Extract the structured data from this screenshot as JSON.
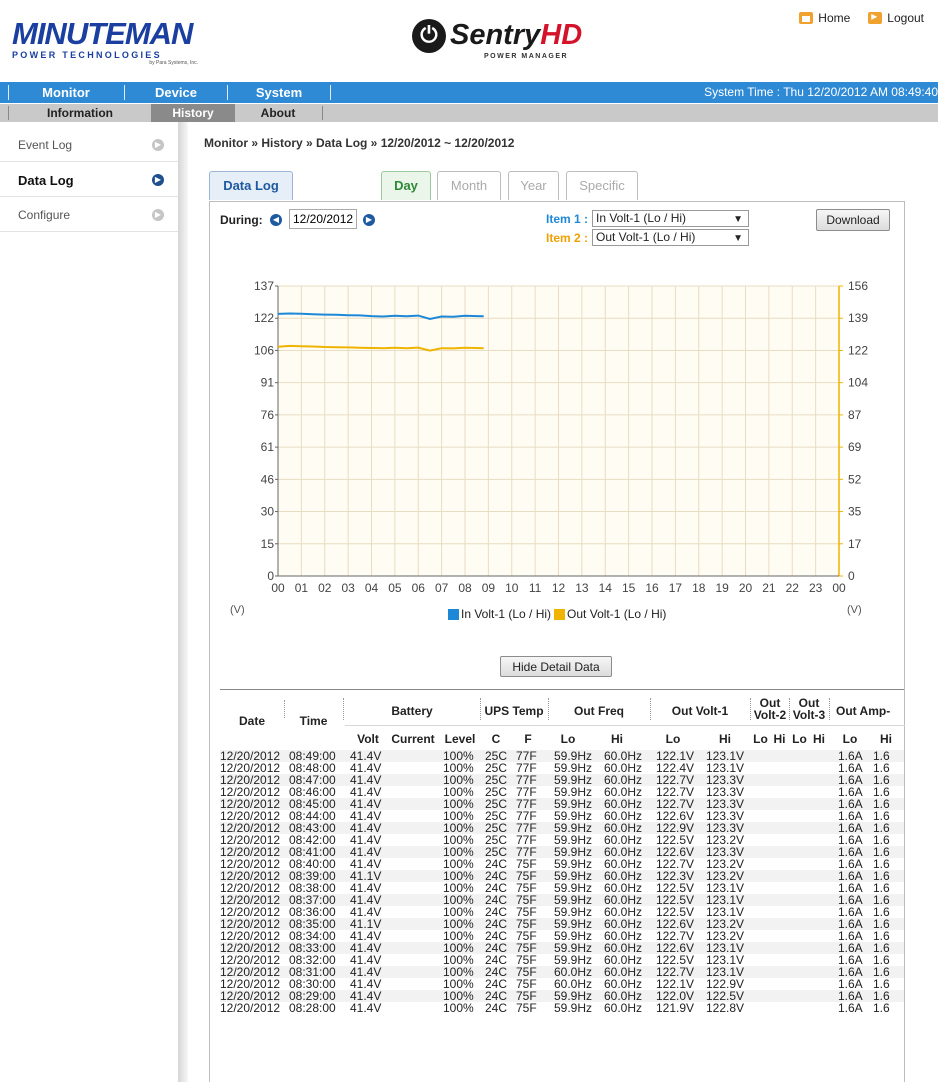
{
  "header": {
    "brand_left_big": "MINUTEMAN",
    "brand_left_sub": "POWER TECHNOLOGIES",
    "brand_left_sub2": "by Para Systems, Inc.",
    "brand_center_main": "Sentry",
    "brand_center_hd": "HD",
    "brand_center_tag": "POWER MANAGER",
    "home_label": "Home",
    "logout_label": "Logout"
  },
  "nav": {
    "monitor": "Monitor",
    "device": "Device",
    "system": "System",
    "system_time": "System Time : Thu 12/20/2012 AM 08:49:40"
  },
  "subnav": {
    "information": "Information",
    "history": "History",
    "about": "About"
  },
  "sidebar": {
    "items": [
      {
        "label": "Event Log"
      },
      {
        "label": "Data Log"
      },
      {
        "label": "Configure"
      }
    ]
  },
  "breadcrumb": "Monitor » History » Data Log  » 12/20/2012 ~ 12/20/2012",
  "tabs": {
    "data_log": "Data Log",
    "day": "Day",
    "month": "Month",
    "year": "Year",
    "specific": "Specific"
  },
  "controls": {
    "during_label": "During:",
    "date_value": "12/20/2012",
    "item1_label": "Item 1 :",
    "item1_value": "In Volt-1 (Lo / Hi)",
    "item2_label": "Item 2 :",
    "item2_value": "Out Volt-1 (Lo / Hi)",
    "download": "Download",
    "hide_detail": "Hide Detail Data"
  },
  "colors": {
    "series1": "#1e88d8",
    "series2": "#f0b400",
    "accent": "#2f8ad6",
    "grid": "#e8dcc2",
    "plot_bg": "#fffdf3"
  },
  "chart_data": {
    "type": "line",
    "x_ticks": [
      "00",
      "01",
      "02",
      "03",
      "04",
      "05",
      "06",
      "07",
      "08",
      "09",
      "10",
      "11",
      "12",
      "13",
      "14",
      "15",
      "16",
      "17",
      "18",
      "19",
      "20",
      "21",
      "22",
      "23",
      "00"
    ],
    "y_left_ticks": [
      "137",
      "122",
      "106",
      "91",
      "76",
      "61",
      "46",
      "30",
      "15",
      "0"
    ],
    "y_right_ticks": [
      "156",
      "139",
      "122",
      "104",
      "87",
      "69",
      "52",
      "35",
      "17",
      "0"
    ],
    "y_left_range": [
      0,
      137
    ],
    "y_right_range": [
      0,
      156
    ],
    "unit_left": "(V)",
    "unit_right": "(V)",
    "series": [
      {
        "name": "In Volt-1 (Lo / Hi)",
        "x": [
          0.0,
          0.5,
          1.0,
          1.5,
          2.0,
          2.5,
          3.0,
          3.5,
          4.0,
          4.5,
          5.0,
          5.5,
          6.0,
          6.5,
          7.0,
          7.5,
          8.0,
          8.5,
          8.8
        ],
        "values": [
          123.8,
          124.0,
          123.9,
          123.7,
          123.5,
          123.4,
          123.2,
          123.1,
          122.8,
          122.6,
          122.9,
          122.7,
          123.0,
          121.4,
          122.6,
          122.5,
          122.9,
          122.8,
          122.7
        ]
      },
      {
        "name": "Out Volt-1 (Lo / Hi)",
        "x": [
          0.0,
          0.5,
          1.0,
          1.5,
          2.0,
          2.5,
          3.0,
          3.5,
          4.0,
          4.5,
          5.0,
          5.5,
          6.0,
          6.5,
          7.0,
          7.5,
          8.0,
          8.5,
          8.8
        ],
        "values": [
          108.3,
          108.7,
          108.5,
          108.4,
          108.2,
          108.1,
          108.0,
          107.8,
          107.7,
          107.6,
          107.8,
          107.6,
          107.9,
          106.5,
          107.6,
          107.5,
          107.8,
          107.7,
          107.6
        ]
      }
    ]
  },
  "table": {
    "headers": {
      "date": "Date",
      "time": "Time",
      "battery": "Battery",
      "ups_temp": "UPS Temp",
      "out_freq": "Out Freq",
      "out_volt1": "Out Volt-1",
      "out_volt2a": "Out",
      "out_volt2b": "Volt-2",
      "out_volt3a": "Out",
      "out_volt3b": "Volt-3",
      "out_amp": "Out Amp-"
    },
    "subheaders": {
      "volt": "Volt",
      "current": "Current",
      "level": "Level",
      "c": "C",
      "f": "F",
      "freq_lo": "Lo",
      "freq_hi": "Hi",
      "v1_lo": "Lo",
      "v1_hi": "Hi",
      "v2_lo": "Lo",
      "v2_hi": "Hi",
      "v3_lo": "Lo",
      "v3_hi": "Hi",
      "amp_lo": "Lo",
      "amp_hi": "Hi"
    },
    "rows": [
      [
        "12/20/2012",
        "08:49:00",
        "41.4V",
        "",
        "100%",
        "25C",
        "77F",
        "59.9Hz",
        "60.0Hz",
        "122.1V",
        "123.1V",
        "1.6A",
        "1.6"
      ],
      [
        "12/20/2012",
        "08:48:00",
        "41.4V",
        "",
        "100%",
        "25C",
        "77F",
        "59.9Hz",
        "60.0Hz",
        "122.4V",
        "123.1V",
        "1.6A",
        "1.6"
      ],
      [
        "12/20/2012",
        "08:47:00",
        "41.4V",
        "",
        "100%",
        "25C",
        "77F",
        "59.9Hz",
        "60.0Hz",
        "122.7V",
        "123.3V",
        "1.6A",
        "1.6"
      ],
      [
        "12/20/2012",
        "08:46:00",
        "41.4V",
        "",
        "100%",
        "25C",
        "77F",
        "59.9Hz",
        "60.0Hz",
        "122.7V",
        "123.3V",
        "1.6A",
        "1.6"
      ],
      [
        "12/20/2012",
        "08:45:00",
        "41.4V",
        "",
        "100%",
        "25C",
        "77F",
        "59.9Hz",
        "60.0Hz",
        "122.7V",
        "123.3V",
        "1.6A",
        "1.6"
      ],
      [
        "12/20/2012",
        "08:44:00",
        "41.4V",
        "",
        "100%",
        "25C",
        "77F",
        "59.9Hz",
        "60.0Hz",
        "122.6V",
        "123.3V",
        "1.6A",
        "1.6"
      ],
      [
        "12/20/2012",
        "08:43:00",
        "41.4V",
        "",
        "100%",
        "25C",
        "77F",
        "59.9Hz",
        "60.0Hz",
        "122.9V",
        "123.3V",
        "1.6A",
        "1.6"
      ],
      [
        "12/20/2012",
        "08:42:00",
        "41.4V",
        "",
        "100%",
        "25C",
        "77F",
        "59.9Hz",
        "60.0Hz",
        "122.5V",
        "123.2V",
        "1.6A",
        "1.6"
      ],
      [
        "12/20/2012",
        "08:41:00",
        "41.4V",
        "",
        "100%",
        "25C",
        "77F",
        "59.9Hz",
        "60.0Hz",
        "122.6V",
        "123.3V",
        "1.6A",
        "1.6"
      ],
      [
        "12/20/2012",
        "08:40:00",
        "41.4V",
        "",
        "100%",
        "24C",
        "75F",
        "59.9Hz",
        "60.0Hz",
        "122.7V",
        "123.2V",
        "1.6A",
        "1.6"
      ],
      [
        "12/20/2012",
        "08:39:00",
        "41.1V",
        "",
        "100%",
        "24C",
        "75F",
        "59.9Hz",
        "60.0Hz",
        "122.3V",
        "123.2V",
        "1.6A",
        "1.6"
      ],
      [
        "12/20/2012",
        "08:38:00",
        "41.4V",
        "",
        "100%",
        "24C",
        "75F",
        "59.9Hz",
        "60.0Hz",
        "122.5V",
        "123.1V",
        "1.6A",
        "1.6"
      ],
      [
        "12/20/2012",
        "08:37:00",
        "41.4V",
        "",
        "100%",
        "24C",
        "75F",
        "59.9Hz",
        "60.0Hz",
        "122.5V",
        "123.1V",
        "1.6A",
        "1.6"
      ],
      [
        "12/20/2012",
        "08:36:00",
        "41.4V",
        "",
        "100%",
        "24C",
        "75F",
        "59.9Hz",
        "60.0Hz",
        "122.5V",
        "123.1V",
        "1.6A",
        "1.6"
      ],
      [
        "12/20/2012",
        "08:35:00",
        "41.1V",
        "",
        "100%",
        "24C",
        "75F",
        "59.9Hz",
        "60.0Hz",
        "122.6V",
        "123.2V",
        "1.6A",
        "1.6"
      ],
      [
        "12/20/2012",
        "08:34:00",
        "41.4V",
        "",
        "100%",
        "24C",
        "75F",
        "59.9Hz",
        "60.0Hz",
        "122.7V",
        "123.2V",
        "1.6A",
        "1.6"
      ],
      [
        "12/20/2012",
        "08:33:00",
        "41.4V",
        "",
        "100%",
        "24C",
        "75F",
        "59.9Hz",
        "60.0Hz",
        "122.6V",
        "123.1V",
        "1.6A",
        "1.6"
      ],
      [
        "12/20/2012",
        "08:32:00",
        "41.4V",
        "",
        "100%",
        "24C",
        "75F",
        "59.9Hz",
        "60.0Hz",
        "122.5V",
        "123.1V",
        "1.6A",
        "1.6"
      ],
      [
        "12/20/2012",
        "08:31:00",
        "41.4V",
        "",
        "100%",
        "24C",
        "75F",
        "60.0Hz",
        "60.0Hz",
        "122.7V",
        "123.1V",
        "1.6A",
        "1.6"
      ],
      [
        "12/20/2012",
        "08:30:00",
        "41.4V",
        "",
        "100%",
        "24C",
        "75F",
        "60.0Hz",
        "60.0Hz",
        "122.1V",
        "122.9V",
        "1.6A",
        "1.6"
      ],
      [
        "12/20/2012",
        "08:29:00",
        "41.4V",
        "",
        "100%",
        "24C",
        "75F",
        "59.9Hz",
        "60.0Hz",
        "122.0V",
        "122.5V",
        "1.6A",
        "1.6"
      ],
      [
        "12/20/2012",
        "08:28:00",
        "41.4V",
        "",
        "100%",
        "24C",
        "75F",
        "59.9Hz",
        "60.0Hz",
        "121.9V",
        "122.8V",
        "1.6A",
        "1.6"
      ]
    ]
  }
}
